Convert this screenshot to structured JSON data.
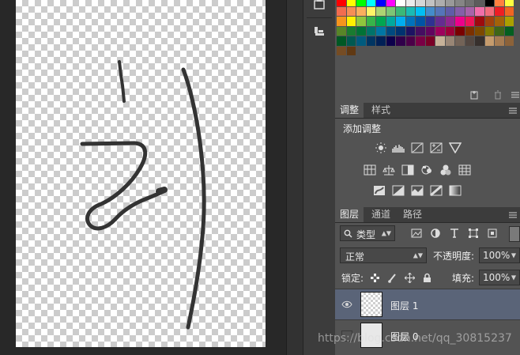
{
  "swatches": [
    "#ff0000",
    "#ffff00",
    "#00ff00",
    "#00ffff",
    "#0000ff",
    "#ff00ff",
    "#ffffff",
    "#ebebeb",
    "#d6d6d6",
    "#c2c2c2",
    "#adadad",
    "#999999",
    "#858585",
    "#707070",
    "#5c5c5c",
    "#000000",
    "#ff8040",
    "#ffff40",
    "#f26c4f",
    "#f68e55",
    "#fbaf5d",
    "#fff467",
    "#acd372",
    "#7cc576",
    "#3bb878",
    "#1abbb4",
    "#00bff3",
    "#438ccb",
    "#5574b9",
    "#605ca8",
    "#855fa8",
    "#a763a9",
    "#f06eaa",
    "#f26d7d",
    "#ee1d24",
    "#f16522",
    "#f7941d",
    "#fff100",
    "#8fc63d",
    "#37b44a",
    "#00a650",
    "#00a99e",
    "#00aeef",
    "#0072bc",
    "#0054a5",
    "#2f3192",
    "#652c91",
    "#91278f",
    "#ec008c",
    "#ed145b",
    "#9d0a0e",
    "#a1410d",
    "#a36209",
    "#aba000",
    "#588528",
    "#197b30",
    "#007236",
    "#00736a",
    "#0076a4",
    "#004a80",
    "#003370",
    "#1d1363",
    "#450e61",
    "#62055f",
    "#9e005d",
    "#9d0039",
    "#790000",
    "#7b3000",
    "#7c4900",
    "#827a00",
    "#3e6617",
    "#045f20",
    "#005824",
    "#005951",
    "#005b7e",
    "#003562",
    "#002056",
    "#0c004b",
    "#30004a",
    "#4b0048",
    "#7a0045",
    "#7a0026",
    "#c7b299",
    "#998675",
    "#736357",
    "#534741",
    "#37302d",
    "#c69c6d",
    "#a67c52",
    "#8c6239",
    "#754c24",
    "#603913"
  ],
  "adjustments": {
    "tab_active": "调整",
    "tab_other": "样式",
    "add_label": "添加调整",
    "row1": [
      "brightness-contrast-icon",
      "levels-icon",
      "curves-icon",
      "exposure-icon",
      "gradient-triangle-icon"
    ],
    "row2": [
      "vibrance-icon",
      "hue-saturation-icon",
      "color-balance-icon",
      "black-white-icon",
      "photo-filter-icon",
      "channel-mixer-icon",
      "color-lookup-icon"
    ],
    "row3": [
      "invert-icon",
      "posterize-icon",
      "threshold-icon",
      "selective-color-icon",
      "gradient-map-icon"
    ]
  },
  "layers": {
    "tabs": [
      "图层",
      "通道",
      "路径"
    ],
    "filter_label": "类型",
    "blend_mode": "正常",
    "opacity_label": "不透明度:",
    "opacity_value": "100%",
    "lock_label": "锁定:",
    "fill_label": "填充:",
    "fill_value": "100%",
    "items": [
      {
        "name": "图层 1",
        "selected": true,
        "visible": true
      },
      {
        "name": "图层 0",
        "selected": false,
        "visible": false
      }
    ]
  },
  "watermark": "https://blog.csdn.net/qq_30815237",
  "colors": {
    "panel_bg": "#535353",
    "workspace_bg": "#282828",
    "selected_layer": "#5a6478",
    "stroke": "#333333"
  }
}
